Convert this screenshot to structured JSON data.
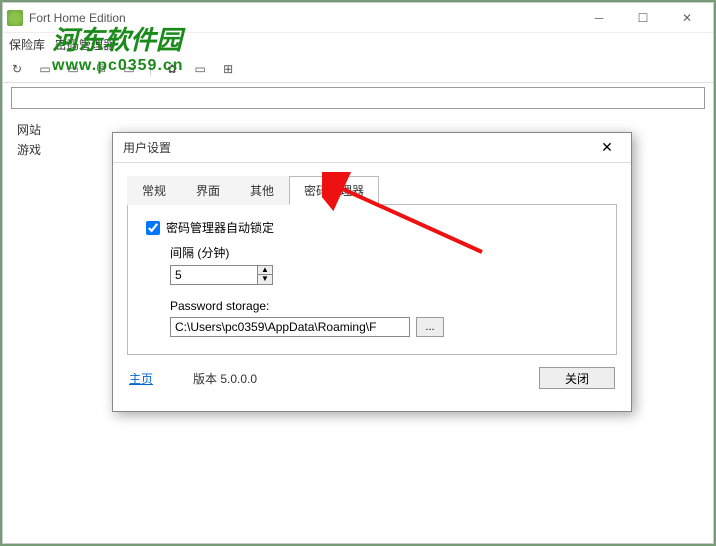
{
  "window": {
    "title": "Fort Home Edition"
  },
  "menubar": {
    "item0": "保险库",
    "item1": "密码管理器"
  },
  "sidebar": {
    "item0": "网站",
    "item1": "游戏"
  },
  "watermark": {
    "cn": "河东软件园",
    "url": "www.pc0359.cn"
  },
  "dialog": {
    "title": "用户设置",
    "tabs": {
      "t0": "常规",
      "t1": "界面",
      "t2": "其他",
      "t3": "密码管理器"
    },
    "autolock_label": "密码管理器自动锁定",
    "interval_label": "间隔 (分钟)",
    "interval_value": "5",
    "storage_label": "Password storage:",
    "storage_path": "C:\\Users\\pc0359\\AppData\\Roaming\\F",
    "browse_label": "...",
    "home_link": "主页",
    "version": "版本 5.0.0.0",
    "close": "关闭"
  }
}
